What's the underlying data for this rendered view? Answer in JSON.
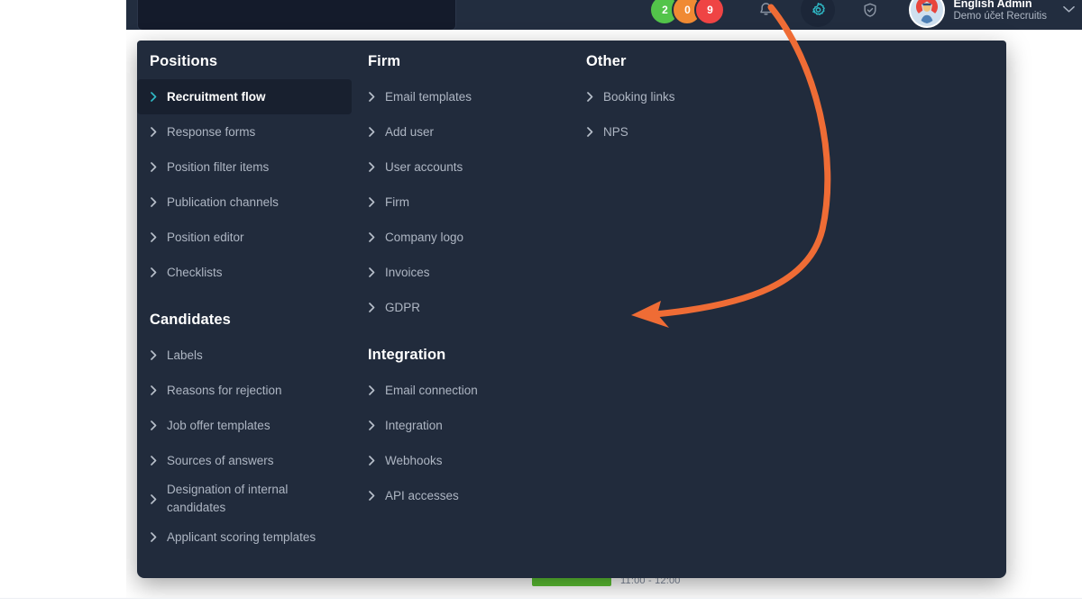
{
  "header": {
    "search": {
      "value": "",
      "placeholder": ""
    },
    "badges": [
      {
        "name": "badge-green",
        "count": "2",
        "color": "#53c44a"
      },
      {
        "name": "badge-orange",
        "count": "0",
        "color": "#f08a33"
      },
      {
        "name": "badge-red",
        "count": "9",
        "color": "#ef4444"
      }
    ],
    "icons": {
      "notifications": "bell-icon",
      "settings": "gear-icon",
      "security": "shield-check-icon",
      "dropdown": "chevron-down-icon"
    },
    "user": {
      "name": "English Admin",
      "account": "Demo účet Recruitis"
    }
  },
  "menu": {
    "columns": [
      {
        "name": "positions-column",
        "groups": [
          {
            "title": "Positions",
            "items": [
              {
                "label": "Recruitment flow",
                "active": true
              },
              {
                "label": "Response forms",
                "active": false
              },
              {
                "label": "Position filter items",
                "active": false
              },
              {
                "label": "Publication channels",
                "active": false
              },
              {
                "label": "Position editor",
                "active": false
              },
              {
                "label": "Checklists",
                "active": false
              }
            ]
          },
          {
            "title": "Candidates",
            "items": [
              {
                "label": "Labels",
                "active": false
              },
              {
                "label": "Reasons for rejection",
                "active": false
              },
              {
                "label": "Job offer templates",
                "active": false
              },
              {
                "label": "Sources of answers",
                "active": false
              },
              {
                "label": "Designation of internal candidates",
                "active": false,
                "wrap": true
              },
              {
                "label": "Applicant scoring templates",
                "active": false
              }
            ]
          }
        ]
      },
      {
        "name": "firm-column",
        "groups": [
          {
            "title": "Firm",
            "items": [
              {
                "label": "Email templates",
                "active": false
              },
              {
                "label": "Add user",
                "active": false
              },
              {
                "label": "User accounts",
                "active": false
              },
              {
                "label": "Firm",
                "active": false
              },
              {
                "label": "Company logo",
                "active": false
              },
              {
                "label": "Invoices",
                "active": false
              },
              {
                "label": "GDPR",
                "active": false
              }
            ]
          },
          {
            "title": "Integration",
            "items": [
              {
                "label": "Email connection",
                "active": false
              },
              {
                "label": "Integration",
                "active": false
              },
              {
                "label": "Webhooks",
                "active": false
              },
              {
                "label": "API accesses",
                "active": false
              }
            ]
          }
        ]
      },
      {
        "name": "other-column",
        "groups": [
          {
            "title": "Other",
            "items": [
              {
                "label": "Booking links",
                "active": false
              },
              {
                "label": "NPS",
                "active": false
              }
            ]
          }
        ]
      }
    ]
  },
  "background_page": {
    "status_pill": "",
    "time_range": "11:00 - 12:00",
    "clock_icon": "clock-icon"
  },
  "annotation": {
    "name": "arrow-annotation",
    "color": "#ef6c35",
    "points_from": "gear-icon",
    "points_to": "menu-panel"
  },
  "colors": {
    "panel_bg": "#212b3c",
    "header_bg": "#222d3f",
    "active_item_bg": "#18202f",
    "accent_teal": "#2fb7c4",
    "annotation_orange": "#ef6c35",
    "page_bg": "#ffffff"
  }
}
